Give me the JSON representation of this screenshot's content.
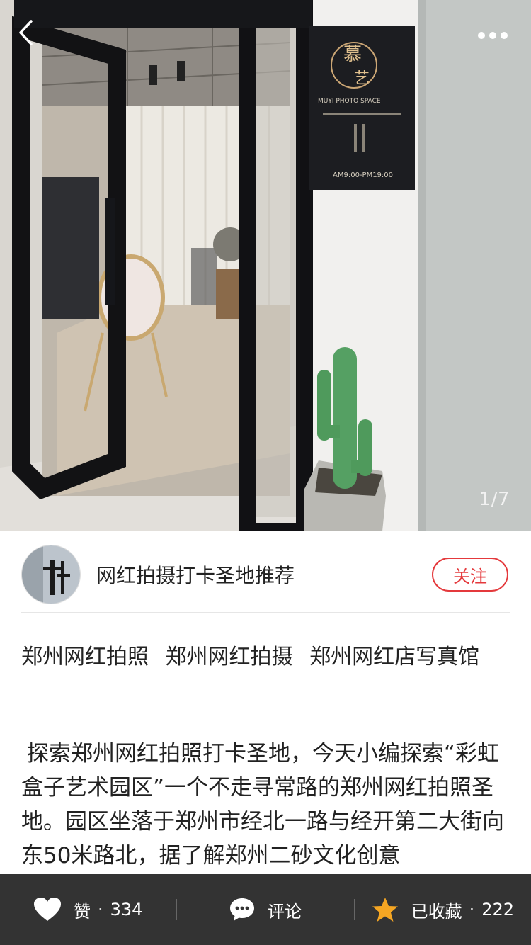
{
  "hero": {
    "page_indicator": "1/7",
    "sign_brand": "慕 艺",
    "sign_subtitle": "MUYI PHOTO SPACE",
    "sign_hours": "AM9:00-PM19:00"
  },
  "author": {
    "name": "网红拍摄打卡圣地推荐",
    "follow_label": "关注"
  },
  "content": {
    "tags": [
      "郑州网红拍照",
      "郑州网红拍摄",
      "郑州网红店写真馆"
    ],
    "body": " 探索郑州网红拍照打卡圣地，今天小编探索“彩虹盒子艺术园区”一个不走寻常路的郑州网红拍照圣地。园区坐落于郑州市经北一路与经开第二大街向东50米路北，据了解郑州二砂文化创意"
  },
  "bottom_bar": {
    "like_label": "赞",
    "like_count": "334",
    "comment_label": "评论",
    "collect_label": "已收藏",
    "collect_count": "222",
    "separator": "·",
    "collect_star_color": "#f5a623"
  }
}
